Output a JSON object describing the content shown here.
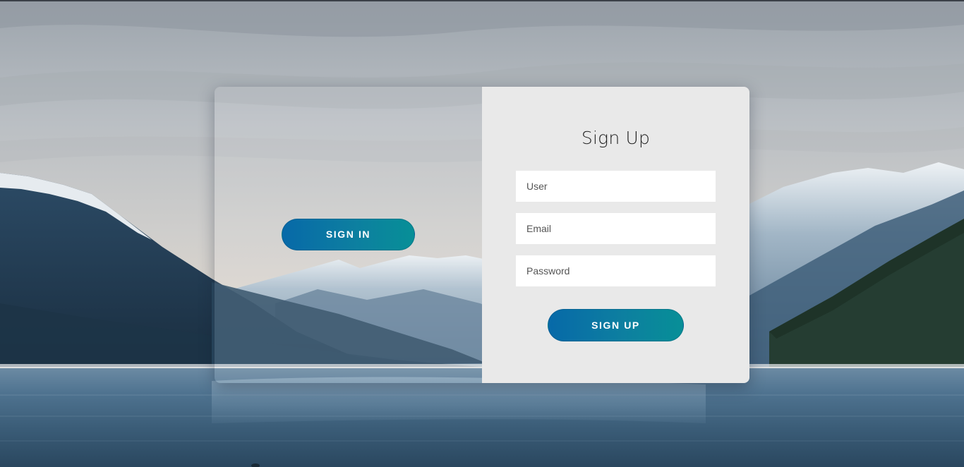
{
  "left_panel": {
    "signin_label": "SIGN IN"
  },
  "signup_form": {
    "title": "Sign Up",
    "user_placeholder": "User",
    "email_placeholder": "Email",
    "password_placeholder": "Password",
    "submit_label": "SIGN UP"
  },
  "theme": {
    "button_gradient_start": "#0769a8",
    "button_gradient_end": "#078f97",
    "form_background": "#e9e9e9",
    "field_background": "#ffffff"
  }
}
